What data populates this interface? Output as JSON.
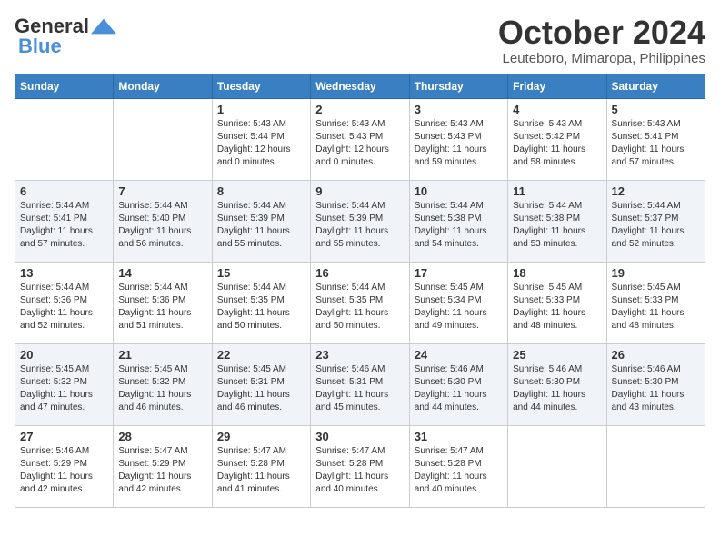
{
  "logo": {
    "line1": "General",
    "line2": "Blue"
  },
  "title": "October 2024",
  "location": "Leuteboro, Mimaropa, Philippines",
  "weekdays": [
    "Sunday",
    "Monday",
    "Tuesday",
    "Wednesday",
    "Thursday",
    "Friday",
    "Saturday"
  ],
  "weeks": [
    [
      {
        "day": "",
        "info": ""
      },
      {
        "day": "",
        "info": ""
      },
      {
        "day": "1",
        "info": "Sunrise: 5:43 AM\nSunset: 5:44 PM\nDaylight: 12 hours\nand 0 minutes."
      },
      {
        "day": "2",
        "info": "Sunrise: 5:43 AM\nSunset: 5:43 PM\nDaylight: 12 hours\nand 0 minutes."
      },
      {
        "day": "3",
        "info": "Sunrise: 5:43 AM\nSunset: 5:43 PM\nDaylight: 11 hours\nand 59 minutes."
      },
      {
        "day": "4",
        "info": "Sunrise: 5:43 AM\nSunset: 5:42 PM\nDaylight: 11 hours\nand 58 minutes."
      },
      {
        "day": "5",
        "info": "Sunrise: 5:43 AM\nSunset: 5:41 PM\nDaylight: 11 hours\nand 57 minutes."
      }
    ],
    [
      {
        "day": "6",
        "info": "Sunrise: 5:44 AM\nSunset: 5:41 PM\nDaylight: 11 hours\nand 57 minutes."
      },
      {
        "day": "7",
        "info": "Sunrise: 5:44 AM\nSunset: 5:40 PM\nDaylight: 11 hours\nand 56 minutes."
      },
      {
        "day": "8",
        "info": "Sunrise: 5:44 AM\nSunset: 5:39 PM\nDaylight: 11 hours\nand 55 minutes."
      },
      {
        "day": "9",
        "info": "Sunrise: 5:44 AM\nSunset: 5:39 PM\nDaylight: 11 hours\nand 55 minutes."
      },
      {
        "day": "10",
        "info": "Sunrise: 5:44 AM\nSunset: 5:38 PM\nDaylight: 11 hours\nand 54 minutes."
      },
      {
        "day": "11",
        "info": "Sunrise: 5:44 AM\nSunset: 5:38 PM\nDaylight: 11 hours\nand 53 minutes."
      },
      {
        "day": "12",
        "info": "Sunrise: 5:44 AM\nSunset: 5:37 PM\nDaylight: 11 hours\nand 52 minutes."
      }
    ],
    [
      {
        "day": "13",
        "info": "Sunrise: 5:44 AM\nSunset: 5:36 PM\nDaylight: 11 hours\nand 52 minutes."
      },
      {
        "day": "14",
        "info": "Sunrise: 5:44 AM\nSunset: 5:36 PM\nDaylight: 11 hours\nand 51 minutes."
      },
      {
        "day": "15",
        "info": "Sunrise: 5:44 AM\nSunset: 5:35 PM\nDaylight: 11 hours\nand 50 minutes."
      },
      {
        "day": "16",
        "info": "Sunrise: 5:44 AM\nSunset: 5:35 PM\nDaylight: 11 hours\nand 50 minutes."
      },
      {
        "day": "17",
        "info": "Sunrise: 5:45 AM\nSunset: 5:34 PM\nDaylight: 11 hours\nand 49 minutes."
      },
      {
        "day": "18",
        "info": "Sunrise: 5:45 AM\nSunset: 5:33 PM\nDaylight: 11 hours\nand 48 minutes."
      },
      {
        "day": "19",
        "info": "Sunrise: 5:45 AM\nSunset: 5:33 PM\nDaylight: 11 hours\nand 48 minutes."
      }
    ],
    [
      {
        "day": "20",
        "info": "Sunrise: 5:45 AM\nSunset: 5:32 PM\nDaylight: 11 hours\nand 47 minutes."
      },
      {
        "day": "21",
        "info": "Sunrise: 5:45 AM\nSunset: 5:32 PM\nDaylight: 11 hours\nand 46 minutes."
      },
      {
        "day": "22",
        "info": "Sunrise: 5:45 AM\nSunset: 5:31 PM\nDaylight: 11 hours\nand 46 minutes."
      },
      {
        "day": "23",
        "info": "Sunrise: 5:46 AM\nSunset: 5:31 PM\nDaylight: 11 hours\nand 45 minutes."
      },
      {
        "day": "24",
        "info": "Sunrise: 5:46 AM\nSunset: 5:30 PM\nDaylight: 11 hours\nand 44 minutes."
      },
      {
        "day": "25",
        "info": "Sunrise: 5:46 AM\nSunset: 5:30 PM\nDaylight: 11 hours\nand 44 minutes."
      },
      {
        "day": "26",
        "info": "Sunrise: 5:46 AM\nSunset: 5:30 PM\nDaylight: 11 hours\nand 43 minutes."
      }
    ],
    [
      {
        "day": "27",
        "info": "Sunrise: 5:46 AM\nSunset: 5:29 PM\nDaylight: 11 hours\nand 42 minutes."
      },
      {
        "day": "28",
        "info": "Sunrise: 5:47 AM\nSunset: 5:29 PM\nDaylight: 11 hours\nand 42 minutes."
      },
      {
        "day": "29",
        "info": "Sunrise: 5:47 AM\nSunset: 5:28 PM\nDaylight: 11 hours\nand 41 minutes."
      },
      {
        "day": "30",
        "info": "Sunrise: 5:47 AM\nSunset: 5:28 PM\nDaylight: 11 hours\nand 40 minutes."
      },
      {
        "day": "31",
        "info": "Sunrise: 5:47 AM\nSunset: 5:28 PM\nDaylight: 11 hours\nand 40 minutes."
      },
      {
        "day": "",
        "info": ""
      },
      {
        "day": "",
        "info": ""
      }
    ]
  ]
}
